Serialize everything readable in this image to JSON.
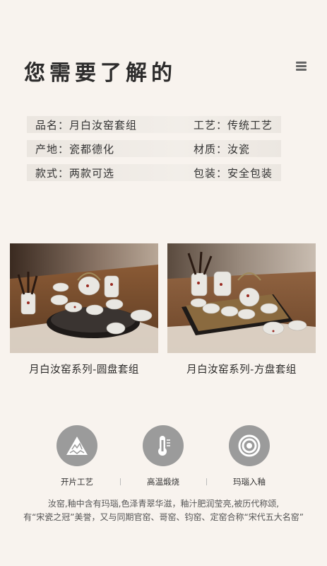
{
  "header": {
    "title": "您需要了解的"
  },
  "specs": [
    {
      "left": "品名：月白汝窑套组",
      "right": "工艺：传统工艺"
    },
    {
      "left": "产地：瓷都德化",
      "right": "材质：汝瓷"
    },
    {
      "left": "款式：两款可选",
      "right": "包装：安全包装"
    }
  ],
  "products": [
    {
      "caption": "月白汝窑系列-圆盘套组"
    },
    {
      "caption": "月白汝窑系列-方盘套组"
    }
  ],
  "features": [
    {
      "label": "开片工艺",
      "icon": "crackle-pyramid-icon"
    },
    {
      "label": "高温煅烧",
      "icon": "thermometer-icon"
    },
    {
      "label": "玛瑙入釉",
      "icon": "agate-ring-icon"
    }
  ],
  "description": {
    "line1": "汝窑,釉中含有玛瑙,色泽青翠华滋，釉汁肥润莹亮,被历代称颂,",
    "line2": "有“宋瓷之冠”美誉，又与同期官窑、哥窑、钧窑、定窑合称“宋代五大名窑”"
  },
  "colors": {
    "background": "#f8f3ee",
    "icon_circle": "#9b9b9b"
  }
}
